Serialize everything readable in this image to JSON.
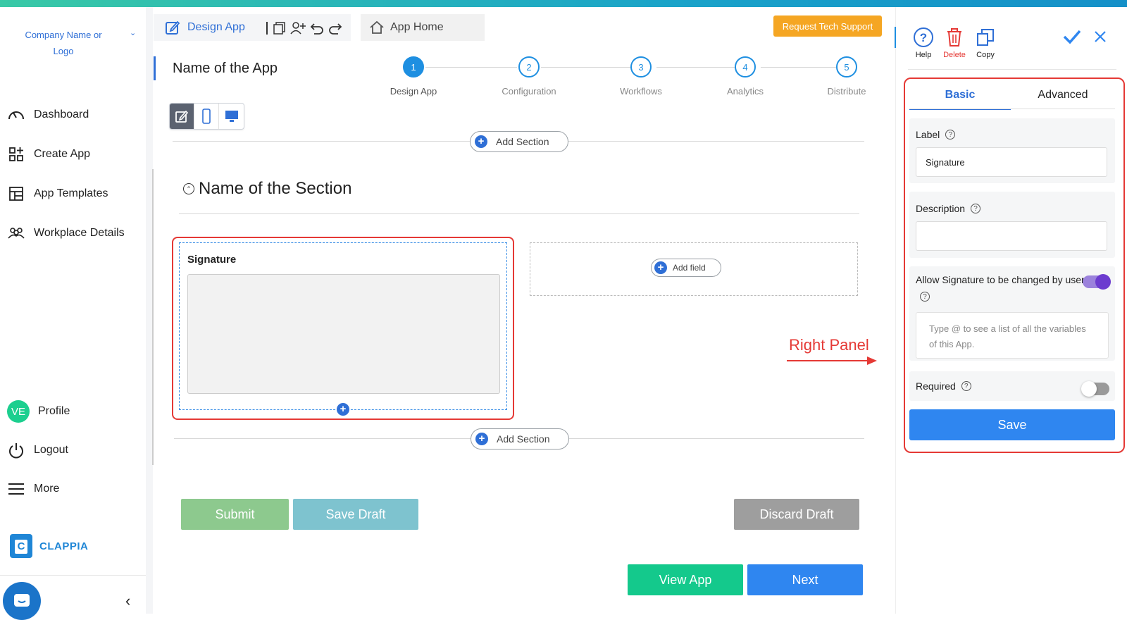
{
  "sidebar": {
    "company": "Company Name or Logo",
    "items": [
      {
        "label": "Dashboard"
      },
      {
        "label": "Create App"
      },
      {
        "label": "App Templates"
      },
      {
        "label": "Workplace Details"
      }
    ],
    "bottom_items": [
      {
        "label": "Profile",
        "avatar": "VE"
      },
      {
        "label": "Logout"
      },
      {
        "label": "More"
      }
    ],
    "brand": "CLAPPIA"
  },
  "header": {
    "tab_design": "Design App",
    "tab_home": "App Home",
    "support_button": "Request Tech Support"
  },
  "app": {
    "name": "Name of the App"
  },
  "stepper": [
    {
      "num": "1",
      "label": "Design App",
      "active": true
    },
    {
      "num": "2",
      "label": "Configuration"
    },
    {
      "num": "3",
      "label": "Workflows"
    },
    {
      "num": "4",
      "label": "Analytics"
    },
    {
      "num": "5",
      "label": "Distribute"
    }
  ],
  "canvas": {
    "add_section": "Add Section",
    "section_title": "Name of the Section",
    "signature_label": "Signature",
    "add_field": "Add field",
    "annotation": "Right Panel"
  },
  "buttons": {
    "submit": "Submit",
    "save_draft": "Save Draft",
    "discard_draft": "Discard Draft",
    "view_app": "View App",
    "next": "Next"
  },
  "right_panel": {
    "tools": {
      "help": "Help",
      "delete": "Delete",
      "copy": "Copy"
    },
    "tabs": {
      "basic": "Basic",
      "advanced": "Advanced"
    },
    "label_title": "Label",
    "label_value": "Signature",
    "description_title": "Description",
    "description_value": "",
    "allow_change": "Allow Signature to be changed by user",
    "allow_change_on": true,
    "variables_placeholder": "Type @ to see a list of all the variables of this App.",
    "required_title": "Required",
    "required_on": false,
    "save": "Save"
  },
  "colors": {
    "accent": "#2f6fd6",
    "annotation_red": "#e53935",
    "toggle_on": "#6c3ccf"
  }
}
